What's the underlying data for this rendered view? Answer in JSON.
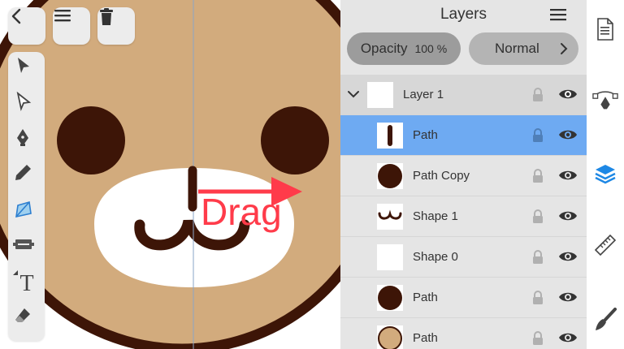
{
  "canvas": {
    "drag_hint": "Drag",
    "colors": {
      "face": "#d2ab7d",
      "outline": "#3d1507",
      "muzzle": "#ffffff",
      "arrow": "#ff3b4a",
      "guide": "#8aa6c8"
    }
  },
  "toolbar": {
    "back": "chevron-left-icon",
    "menu": "hamburger-icon",
    "delete": "trash-icon",
    "tools": [
      "select-icon",
      "direct-select-icon",
      "pen-icon",
      "pencil-icon",
      "node-tool-icon",
      "shape-builder-icon",
      "text-icon",
      "eraser-icon"
    ],
    "active_tool": "node-tool-icon",
    "text_tool_glyph": "T"
  },
  "layers_panel": {
    "title": "Layers",
    "opacity_label": "Opacity",
    "opacity_value": "100 %",
    "blend_mode": "Normal",
    "layers": [
      {
        "name": "Layer 1",
        "type": "group",
        "expanded": true
      },
      {
        "name": "Path",
        "thumb": "vertical-bar",
        "selected": true
      },
      {
        "name": "Path Copy",
        "thumb": "circle"
      },
      {
        "name": "Shape 1",
        "thumb": "mouth"
      },
      {
        "name": "Shape 0",
        "thumb": "blank"
      },
      {
        "name": "Path",
        "thumb": "circle"
      },
      {
        "name": "Path",
        "thumb": "tan-circle"
      }
    ]
  },
  "side_rail": {
    "items": [
      "document-icon",
      "path-edit-icon",
      "layers-icon",
      "ruler-icon",
      "brush-icon"
    ],
    "active": "layers-icon"
  }
}
